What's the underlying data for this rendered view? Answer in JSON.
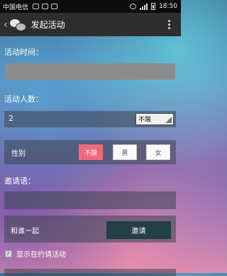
{
  "statusbar": {
    "carrier": "中国电信",
    "time": "18:50"
  },
  "titlebar": {
    "back_glyph": "‹",
    "title": "发起活动",
    "icon": "wechat-bubbles-icon"
  },
  "form": {
    "time_label": "活动时间：",
    "count_label": "活动人数：",
    "count_value": "2",
    "count_limit_option": "不限",
    "gender_label": "性别",
    "gender_options": [
      "不限",
      "男",
      "女"
    ],
    "gender_selected": "不限",
    "invite_label": "邀请语：",
    "with_label": "和谁一起",
    "invite_button": "邀请",
    "show_checkbox_label": "显示在约请活动",
    "show_checkbox_checked": true
  },
  "colors": {
    "gender_selected": "#ee6a7a",
    "invite_button": "#233f47"
  }
}
